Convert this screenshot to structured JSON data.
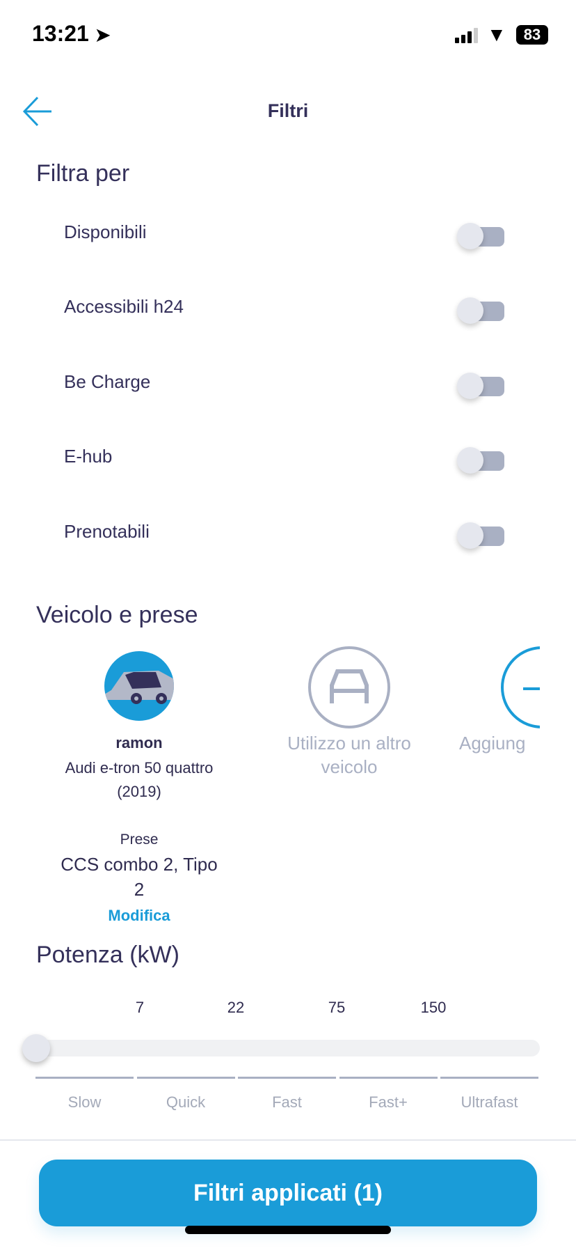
{
  "status": {
    "time": "13:21",
    "battery": "83"
  },
  "header": {
    "title": "Filtri",
    "back_icon": "arrow-left-icon"
  },
  "filters": {
    "title": "Filtra per",
    "items": [
      {
        "label": "Disponibili",
        "on": false
      },
      {
        "label": "Accessibili h24",
        "on": false
      },
      {
        "label": "Be Charge",
        "on": false
      },
      {
        "label": "E-hub",
        "on": false
      },
      {
        "label": "Prenotabili",
        "on": false
      }
    ]
  },
  "vehicles": {
    "title": "Veicolo e prese",
    "selected": {
      "name": "ramon",
      "model": "Audi e-tron 50 quattro",
      "year": "(2019)",
      "sockets_label": "Prese",
      "sockets_line1": "CCS combo 2, Tipo",
      "sockets_line2": "2",
      "edit": "Modifica"
    },
    "other": {
      "line1": "Utilizzo un altro",
      "line2": "veicolo"
    },
    "add": {
      "label": "Aggiung"
    }
  },
  "power": {
    "title": "Potenza (kW)",
    "ticks": [
      "7",
      "22",
      "75",
      "150"
    ],
    "categories": [
      "Slow",
      "Quick",
      "Fast",
      "Fast+",
      "Ultrafast"
    ],
    "value": 0
  },
  "footer": {
    "apply": "Filtri applicati (1)"
  },
  "colors": {
    "accent": "#1a9cd8",
    "text": "#34305a",
    "muted": "#a9b0c3"
  }
}
